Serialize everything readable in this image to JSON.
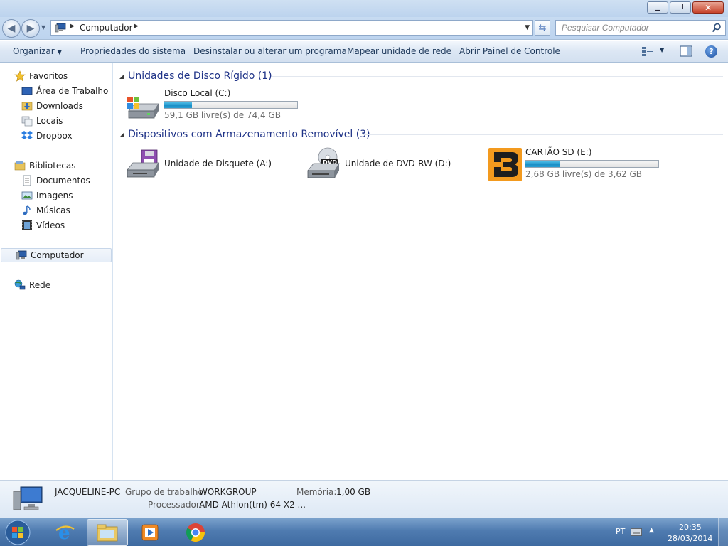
{
  "address": {
    "path": "Computador",
    "search_placeholder": "Pesquisar Computador"
  },
  "commands": {
    "organize": "Organizar",
    "system_props": "Propriedades do sistema",
    "uninstall": "Desinstalar ou alterar um programa",
    "map_drive": "Mapear unidade de rede",
    "control_panel": "Abrir Painel de Controle"
  },
  "nav": {
    "favorites": "Favoritos",
    "desktop": "Área de Trabalho",
    "downloads": "Downloads",
    "places": "Locais",
    "dropbox": "Dropbox",
    "libraries": "Bibliotecas",
    "documents": "Documentos",
    "images": "Imagens",
    "music": "Músicas",
    "videos": "Vídeos",
    "computer": "Computador",
    "network": "Rede"
  },
  "groups": {
    "hdd_header": "Unidades de Disco Rígido (1)",
    "removable_header": "Dispositivos com Armazenamento Removível (3)"
  },
  "drives": {
    "local_c": {
      "name": "Disco Local (C:)",
      "free": "59,1 GB livre(s) de 74,4 GB",
      "used_fraction": 0.206
    },
    "floppy_a": {
      "name": "Unidade de Disquete (A:)"
    },
    "dvd_d": {
      "name": "Unidade de DVD-RW (D:)",
      "badge": "DVD"
    },
    "sd_e": {
      "name": "CARTÃO SD (E:)",
      "free": "2,68 GB livre(s) de 3,62 GB",
      "used_fraction": 0.26
    }
  },
  "details": {
    "pc_name": "JACQUELINE-PC",
    "workgroup_label": "Grupo de trabalho:",
    "workgroup_value": "WORKGROUP",
    "memory_label": "Memória:",
    "memory_value": "1,00 GB",
    "processor_label": "Processador:",
    "processor_value": "AMD Athlon(tm) 64 X2 ..."
  },
  "taskbar": {
    "lang": "PT",
    "time": "20:35",
    "date": "28/03/2014"
  },
  "colors": {
    "group_header": "#1e3287",
    "capacity_fill": "#2a9ed3",
    "sd_brand": "#f39a1e"
  }
}
